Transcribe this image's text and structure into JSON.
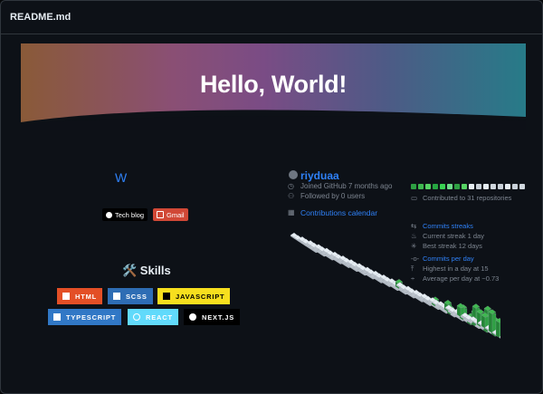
{
  "file": {
    "title": "README.md"
  },
  "banner": {
    "title": "Hello, World!",
    "colors": [
      "#8a5a38",
      "#7a4c85",
      "#277b88"
    ]
  },
  "left": {
    "w_link": "W",
    "badges": [
      {
        "label": "Tech blog",
        "color": "#000000"
      },
      {
        "label": "Gmail",
        "color": "#d14836"
      }
    ],
    "skills_title": "🛠️ Skills",
    "skills": [
      {
        "label": "HTML",
        "color": "#e34f26"
      },
      {
        "label": "SCSS",
        "color": "#2e6db4"
      },
      {
        "label": "JAVASCRIPT",
        "color": "#f7df1e"
      },
      {
        "label": "TYPESCRIPT",
        "color": "#3178c6"
      },
      {
        "label": "REACT",
        "color": "#61dafb"
      },
      {
        "label": "NEXT.JS",
        "color": "#000000"
      }
    ]
  },
  "profile": {
    "username": "riyduaa",
    "joined": "Joined GitHub 7 months ago",
    "followed": "Followed by 0 users",
    "contributions_link": "Contributions calendar"
  },
  "stats": {
    "contributed": "Contributed to 31 repositories",
    "streaks_title": "Commits streaks",
    "current_streak": "Current streak 1 day",
    "best_streak": "Best streak 12 days",
    "per_day_title": "Commits per day",
    "highest": "Highest in a day at 15",
    "average": "Average per day at ~0.73",
    "square_colors": [
      "#2ea043",
      "#3fb950",
      "#56d364",
      "#26a641",
      "#39d353",
      "#6fdd8b",
      "#2ea043",
      "#56d364",
      "#e6edf3",
      "#c9d1d9",
      "#e6edf3",
      "#d0d7de",
      "#c9d1d9",
      "#e6edf3",
      "#c9d1d9",
      "#d0d7de"
    ]
  }
}
